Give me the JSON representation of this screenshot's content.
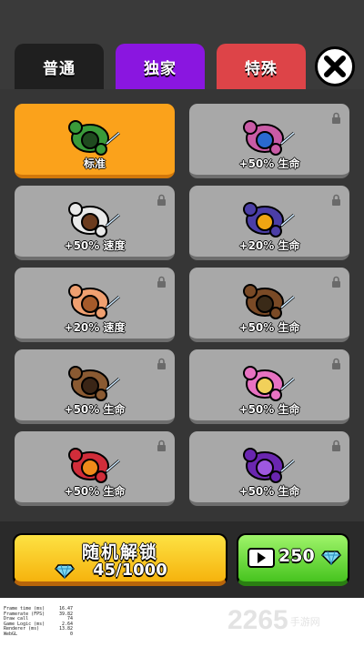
{
  "tabs": [
    {
      "label": "普通"
    },
    {
      "label": "独家"
    },
    {
      "label": "特殊"
    }
  ],
  "close_icon": "close-x-icon",
  "cards": [
    {
      "label": "标准",
      "selected": true,
      "locked": false,
      "skin": "#3a9b3a",
      "hair": "#1f4a1f"
    },
    {
      "label": "+50% 生命",
      "selected": false,
      "locked": true,
      "skin": "#c95ba6",
      "hair": "#2a6ad0"
    },
    {
      "label": "+50% 速度",
      "selected": false,
      "locked": true,
      "skin": "#e9e9e9",
      "hair": "#6b3b1e"
    },
    {
      "label": "+20% 生命",
      "selected": false,
      "locked": true,
      "skin": "#4b3ea7",
      "hair": "#f0a612"
    },
    {
      "label": "+20% 速度",
      "selected": false,
      "locked": true,
      "skin": "#f0a070",
      "hair": "#a55a2a"
    },
    {
      "label": "+50% 生命",
      "selected": false,
      "locked": true,
      "skin": "#7a4a26",
      "hair": "#3a2a18"
    },
    {
      "label": "+50% 生命",
      "selected": false,
      "locked": true,
      "skin": "#8a5a32",
      "hair": "#3a2516"
    },
    {
      "label": "+50% 生命",
      "selected": false,
      "locked": true,
      "skin": "#e872c2",
      "hair": "#f1d05a"
    },
    {
      "label": "+50% 生命",
      "selected": false,
      "locked": true,
      "skin": "#d12d3a",
      "hair": "#f08a1a"
    },
    {
      "label": "+50% 生命",
      "selected": false,
      "locked": true,
      "skin": "#6a26b0",
      "hair": "#9e58e0"
    }
  ],
  "unlock": {
    "title": "随机解锁",
    "count": "45/1000",
    "gem_icon": "diamond-icon"
  },
  "video": {
    "count": "250",
    "icon": "video-play-icon",
    "gem_icon": "diamond-icon"
  },
  "debug": [
    {
      "k": "Frame time (ms)",
      "v": "16.47"
    },
    {
      "k": "Framerate (FPS)",
      "v": "39.82"
    },
    {
      "k": "Draw call",
      "v": "74"
    },
    {
      "k": "Game Logic (ms)",
      "v": "2.64"
    },
    {
      "k": "Renderer (ms)",
      "v": "13.82"
    },
    {
      "k": "WebGL",
      "v": "0"
    }
  ],
  "watermark": {
    "text": "2265",
    "sub": "手游网"
  },
  "colors": {
    "selected": "#fba21b",
    "locked": "#a8a8a8",
    "tab_special": "#dd4448",
    "tab_exclusive": "#8a16e0"
  }
}
